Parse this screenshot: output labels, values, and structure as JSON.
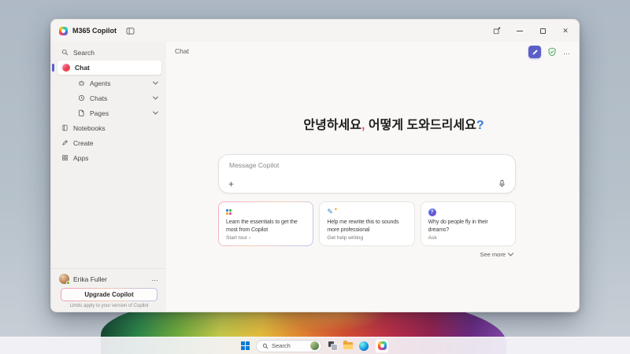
{
  "titlebar": {
    "app_title": "M365 Copilot"
  },
  "sidebar": {
    "search_label": "Search",
    "chat_label": "Chat",
    "tree": [
      {
        "label": "Agents"
      },
      {
        "label": "Chats"
      },
      {
        "label": "Pages"
      }
    ],
    "nav": [
      {
        "label": "Notebooks"
      },
      {
        "label": "Create"
      },
      {
        "label": "Apps"
      }
    ],
    "account": {
      "name": "Erika Fuller"
    },
    "upgrade_button": "Upgrade Copilot",
    "limits_note": "Limits apply to your version of Copilot"
  },
  "main": {
    "header_title": "Chat",
    "greeting": {
      "part1": "안녕하세요",
      "comma": ",",
      "part2": " 어떻게 도와드리세요",
      "question_mark": "?"
    },
    "composer": {
      "placeholder": "Message Copilot"
    },
    "suggestions": [
      {
        "title": "Learn the essentials to get the most from Copilot",
        "action": "Start tour ›"
      },
      {
        "title": "Help me rewrite this to sounds more professional",
        "action": "Get help writing"
      },
      {
        "title": "Why do people fly in their dreams?",
        "action": "Ask",
        "icon_glyph": "?"
      }
    ],
    "see_more": "See more"
  },
  "taskbar": {
    "search_label": "Search"
  },
  "icons": {
    "plus-icon": "+",
    "more-icon": "…",
    "rewrite-pen-icon": "✎",
    "sparkle-icon": "✦",
    "copilot-logo": "multicolor-loop",
    "search-icon": "magnifier",
    "chevron-down-icon": "chevron-down",
    "agents-icon": "bot",
    "chats-icon": "history-clock",
    "pages-icon": "document",
    "notebooks-icon": "notebook",
    "create-icon": "pen",
    "apps-icon": "grid",
    "new-chat-icon": "pencil-square",
    "shield-check-icon": "shield-check",
    "mic-icon": "microphone",
    "minimize-icon": "dash",
    "maximize-icon": "square",
    "close-icon": "x",
    "open-new-window-icon": "popout",
    "sidebar-toggle-icon": "panel",
    "windows-start-icon": "windows-logo",
    "task-view-icon": "layered-squares",
    "file-explorer-icon": "folder",
    "edge-icon": "edge-swirl"
  },
  "colors": {
    "accent": "#5b5fc7",
    "greeting_comma": "#e0566b",
    "greeting_question": "#3a7bd5",
    "shield_green": "#42a55a",
    "chat_icon_gradient_start": "#f9a8c5",
    "chat_icon_gradient_end": "#e4561c",
    "upgrade_border_from": "#ef9dbd",
    "upgrade_border_to": "#b9bff0",
    "presence_green": "#6bb700"
  }
}
